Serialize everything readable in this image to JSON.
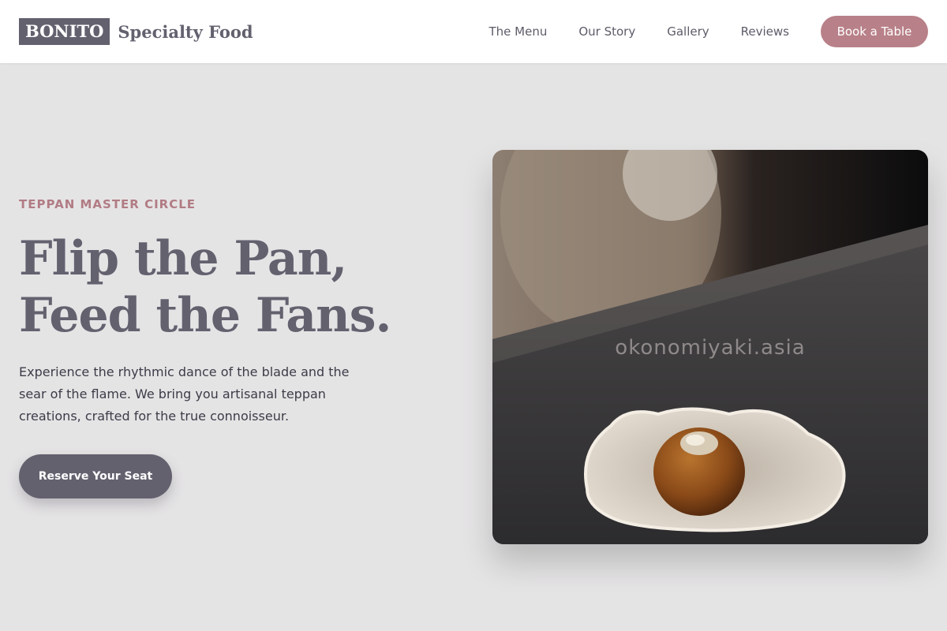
{
  "header": {
    "logo_box": "BONITO",
    "logo_text": "Specialty Food",
    "nav": [
      "The Menu",
      "Our Story",
      "Gallery",
      "Reviews"
    ],
    "cta": "Book a Table"
  },
  "hero": {
    "eyebrow": "TEPPAN MASTER CIRCLE",
    "headline_line1": "Flip the Pan,",
    "headline_line2": "Feed the Fans.",
    "description": "Experience the rhythmic dance of the blade and the sear of the flame. We bring you artisanal teppan creations, crafted for the true connoisseur.",
    "cta": "Reserve Your Seat",
    "image_watermark": "okonomiyaki.asia"
  },
  "colors": {
    "brand": "#64616f",
    "accent": "#b88088",
    "background": "#e5e4e5"
  }
}
